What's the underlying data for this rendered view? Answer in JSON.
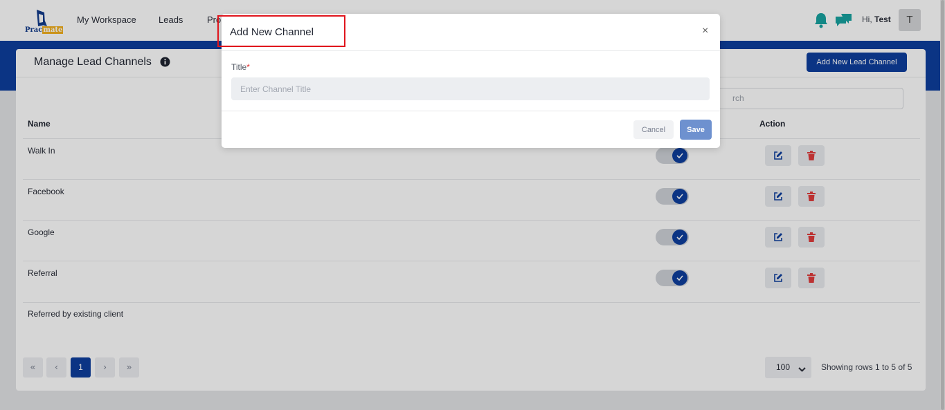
{
  "header": {
    "logo_text_left": "Prac",
    "logo_text_right": "mate",
    "nav": [
      "My Workspace",
      "Leads",
      "Pro"
    ],
    "greeting": "Hi,",
    "user_name": "Test",
    "avatar_initial": "T"
  },
  "page": {
    "title": "Manage Lead Channels",
    "add_button": "Add New Lead Channel",
    "search_placeholder": "Search",
    "search_visible": "rch",
    "columns": {
      "name": "Name",
      "action": "Action"
    },
    "rows": [
      {
        "name": "Walk In",
        "active": true
      },
      {
        "name": "Facebook",
        "active": true
      },
      {
        "name": "Google",
        "active": true
      },
      {
        "name": "Referral",
        "active": true
      },
      {
        "name": "Referred by existing client",
        "active": null
      }
    ],
    "pagination": {
      "first": "«",
      "prev": "‹",
      "current": "1",
      "next": "›",
      "last": "»",
      "per_page": "100",
      "showing": "Showing rows 1 to  5 of 5"
    }
  },
  "modal": {
    "title": "Add New Channel",
    "close": "×",
    "field_label": "Title",
    "required_mark": "*",
    "field_placeholder": "Enter Channel Title",
    "field_value": "",
    "cancel": "Cancel",
    "save": "Save"
  },
  "colors": {
    "brand": "#0e3f9e",
    "accent_teal": "#17a2a0",
    "danger": "#e03c3c",
    "highlight": "#e0141c"
  },
  "icons": {
    "bell": "bell-icon",
    "chat": "chat-icon",
    "info": "info-icon",
    "edit": "edit-icon",
    "delete": "trash-icon",
    "check": "check-icon"
  }
}
